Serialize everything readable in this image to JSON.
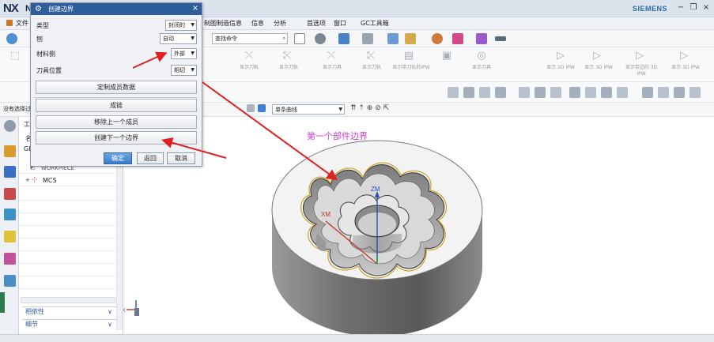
{
  "app": {
    "logo": "NX",
    "logo_suffix": "N",
    "brand": "SIEMENS",
    "window_controls": [
      "−",
      "❐",
      "×"
    ]
  },
  "menubar": {
    "items": [
      "文件",
      "制图制造信息",
      "信息",
      "分析",
      "首选项",
      "窗口",
      "GC工具箱"
    ],
    "item_keys": [
      "file",
      "pmi",
      "info",
      "analysis",
      "preferences",
      "window",
      "gc-toolbox"
    ]
  },
  "toolbar": {
    "search_placeholder": "查找命令",
    "filter_label": "没有选择过滤器",
    "curve_rule": "单条曲线"
  },
  "ribbon": {
    "tools": [
      "显示刀轨",
      "显示刀轨",
      "显示刀具",
      "显示刀轨",
      "显示带刀轨的IPW",
      "显示刀具",
      "显示 2D IPW",
      "显示 3D IPW",
      "显示带边的 3D IPW",
      "显示 3D IPW"
    ]
  },
  "dialog": {
    "title": "创建边界",
    "type_label": "类型",
    "type_value": "封闭的",
    "plane_label": "刨",
    "plane_value": "自动",
    "material_side_label": "材料侧",
    "material_side_value": "外部",
    "tool_position_label": "刀具位置",
    "tool_position_value": "相切",
    "customize_button": "定制成员数据",
    "chain_button": "成链",
    "remove_button": "移除上一个成员",
    "create_next_button": "创建下一个边界",
    "ok_button": "确定",
    "back_button": "返回",
    "cancel_button": "取消"
  },
  "navigator": {
    "header": "工",
    "name_col": "名",
    "geometry_root": "GE",
    "workpiece": "WORKPIECE",
    "mcs": "MCS",
    "dependency": "相依性",
    "details": "细节"
  },
  "viewport": {
    "annotation": "第一个部件边界",
    "axis_zm": "ZM",
    "axis_xm": "XM",
    "triad_x": "X"
  },
  "colors": {
    "annotation": "#d23bd8",
    "arrow": "#e02020",
    "dialog_title": "#2d5d9b",
    "boundary": "#c9a227"
  }
}
